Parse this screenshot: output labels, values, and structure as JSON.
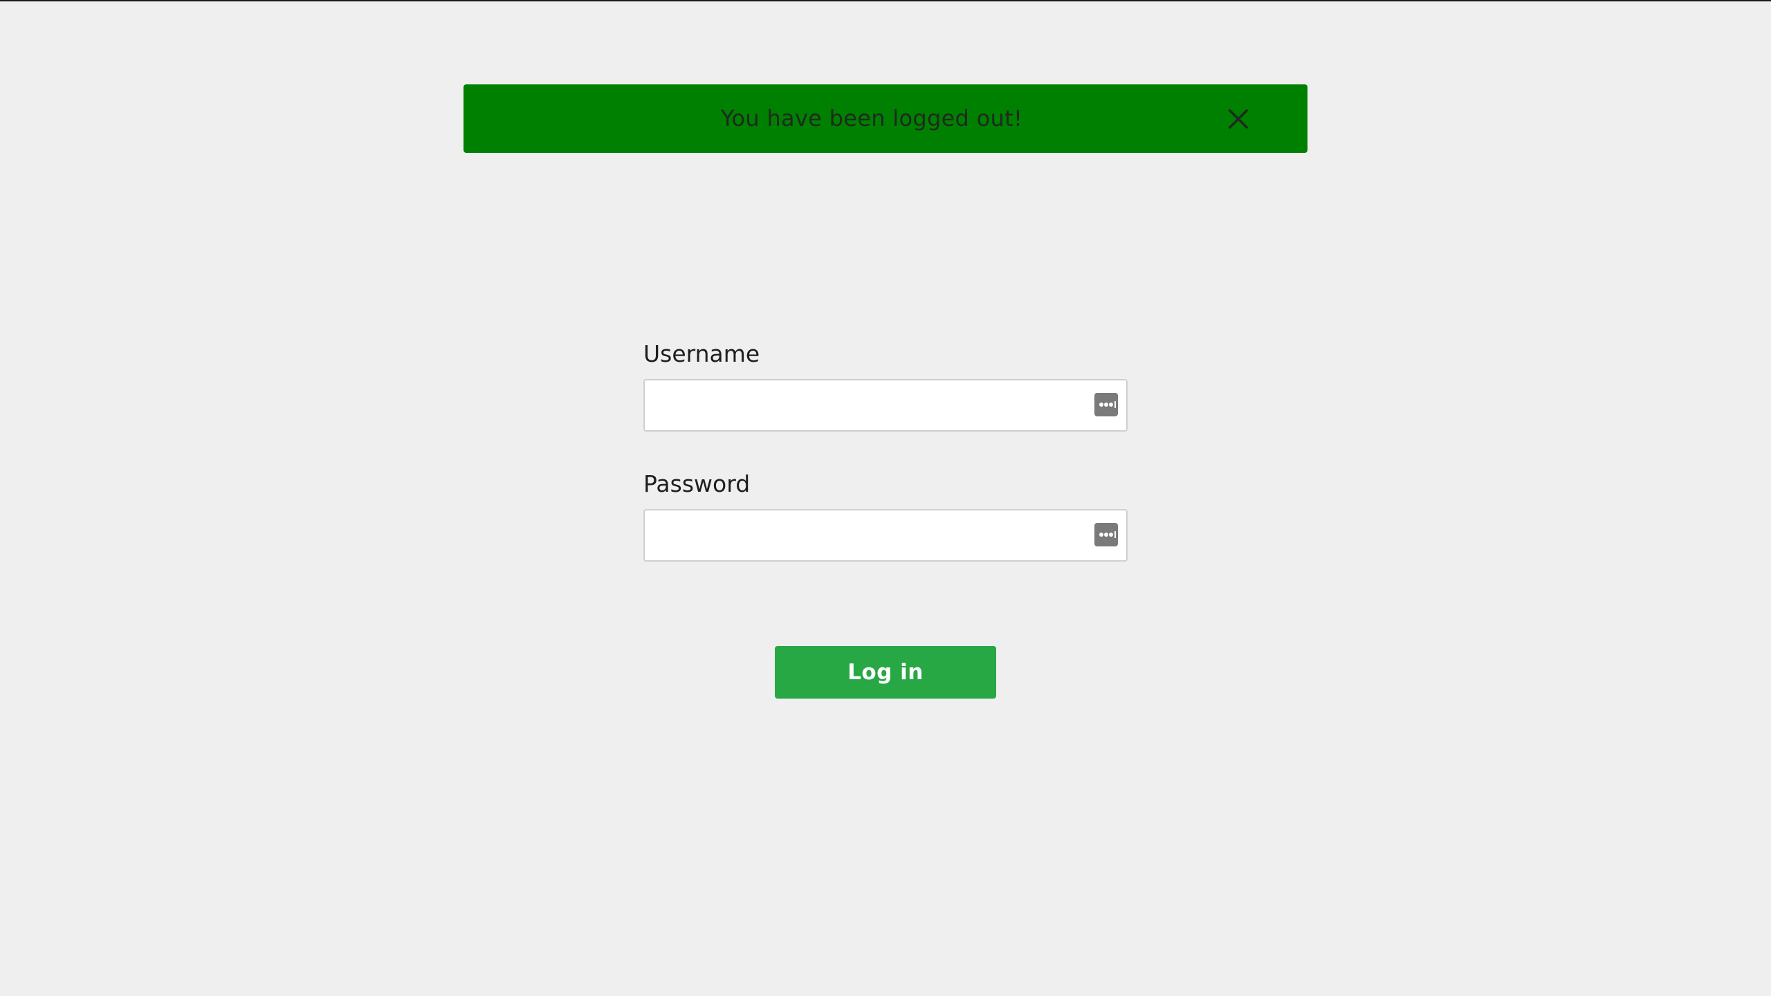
{
  "alert": {
    "message": "You have been logged out!",
    "close_icon": "close-icon",
    "background_color": "#008000"
  },
  "form": {
    "username_label": "Username",
    "username_value": "",
    "username_placeholder": "",
    "password_label": "Password",
    "password_value": "",
    "password_placeholder": "",
    "password_manager_icon": "password-manager-icon"
  },
  "actions": {
    "login_label": "Log in",
    "login_color": "#28a745"
  }
}
